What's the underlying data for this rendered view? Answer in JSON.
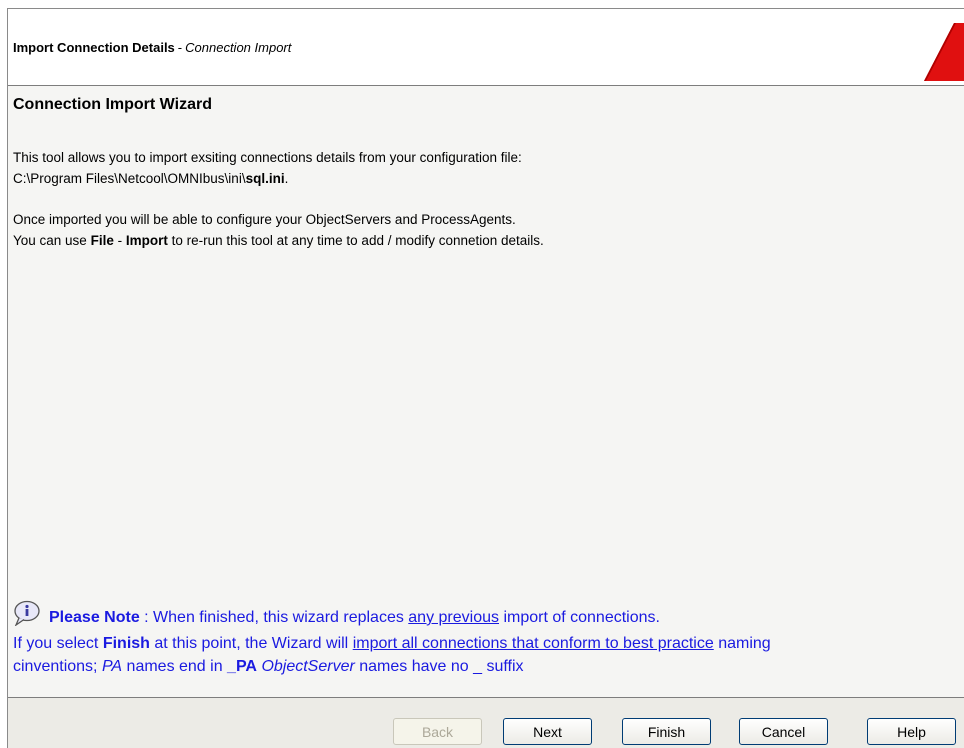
{
  "header": {
    "title": "Import Connection Details",
    "separator": "-",
    "subtitle": "Connection Import"
  },
  "wizard": {
    "title": "Connection Import Wizard",
    "intro_line1": "This tool allows you to import exsiting connections details from your configuration file:",
    "path_prefix": "C:\\Program Files\\Netcool\\OMNIbus\\ini\\",
    "path_file": "sql.ini",
    "path_suffix": ".",
    "info_line1": "Once imported you will be able to configure your ObjectServers and ProcessAgents.",
    "info_line2_pre": "You can use ",
    "info_line2_file": "File",
    "info_line2_dash": " - ",
    "info_line2_import": "Import",
    "info_line2_post": " to re-run this tool at any time to add / modify connetion details."
  },
  "note": {
    "label": "Please Note",
    "line1_pre": " : When finished, this wizard replaces ",
    "line1_link": "any previous",
    "line1_post": " import of connections.",
    "line2_pre": "If you select ",
    "line2_finish": "Finish",
    "line2_mid": " at this point, the Wizard will ",
    "line2_link": "import all connections that conform to best practice",
    "line2_post": " naming",
    "line3_pre": "cinventions; ",
    "line3_pa": "PA",
    "line3_mid": " names end in ",
    "line3_suffix": "_PA",
    "line3_sp": " ",
    "line3_os": "ObjectServer",
    "line3_post": " names have no _ suffix"
  },
  "buttons": {
    "back": "Back",
    "next": "Next",
    "finish": "Finish",
    "cancel": "Cancel",
    "help": "Help"
  },
  "icons": {
    "warning": "warning-triangle-icon",
    "info": "speech-bubble-info-icon"
  },
  "colors": {
    "note_text": "#1a1ae0",
    "warning_red": "#e01010"
  }
}
